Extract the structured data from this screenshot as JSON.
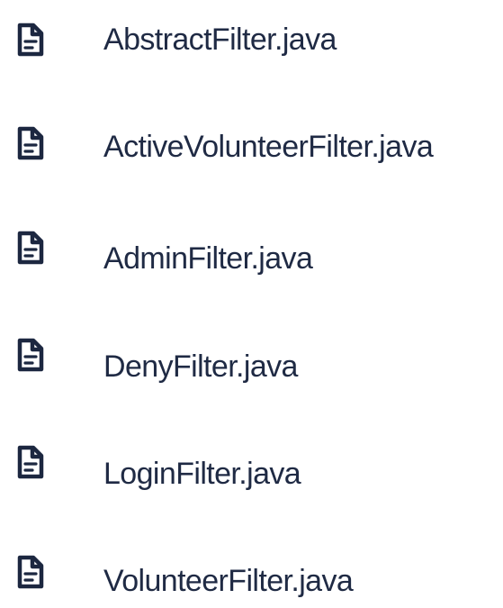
{
  "file_list": {
    "icon": "file-text-icon",
    "text_color": "#1f2a44",
    "icon_color": "#1c2740",
    "items": [
      {
        "name": "AbstractFilter.java"
      },
      {
        "name": "ActiveVolunteerFilter.java"
      },
      {
        "name": "AdminFilter.java"
      },
      {
        "name": "DenyFilter.java"
      },
      {
        "name": "LoginFilter.java"
      },
      {
        "name": "VolunteerFilter.java"
      }
    ]
  }
}
